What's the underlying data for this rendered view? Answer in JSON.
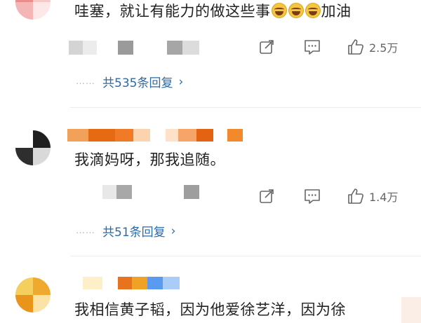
{
  "comments": [
    {
      "text": "哇塞，就让有能力的做这些事",
      "text_suffix": "加油",
      "emoji_icon": "laughing-tears-emoji",
      "like_count": "2.5万",
      "reply_link": "共535条回复",
      "chevron": "›"
    },
    {
      "text": "我滴妈呀，那我追随。",
      "like_count": "1.4万",
      "reply_link": "共51条回复",
      "chevron": "›"
    },
    {
      "text": "我相信黄子韬，因为他爱徐艺洋，因为徐"
    }
  ],
  "ui": {
    "reply_dots": "……",
    "link_color": "#2c6aa8",
    "icon_color": "#666666"
  }
}
